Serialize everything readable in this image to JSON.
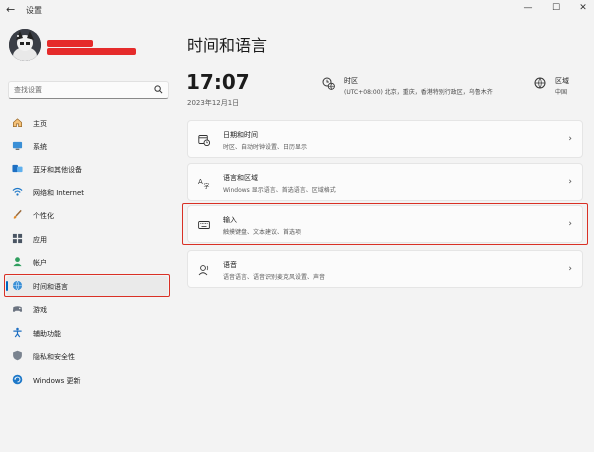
{
  "window": {
    "title": "设置",
    "back_glyph": "←",
    "minimize_glyph": "—",
    "maximize_glyph": "☐",
    "close_glyph": "✕"
  },
  "search": {
    "placeholder": "查找设置"
  },
  "sidebar": {
    "items": [
      {
        "label": "主页",
        "icon": "home-icon"
      },
      {
        "label": "系统",
        "icon": "system-monitor-icon"
      },
      {
        "label": "蓝牙和其他设备",
        "icon": "bluetooth-icon"
      },
      {
        "label": "网络和 Internet",
        "icon": "wifi-icon"
      },
      {
        "label": "个性化",
        "icon": "brush-icon"
      },
      {
        "label": "应用",
        "icon": "apps-icon"
      },
      {
        "label": "帐户",
        "icon": "account-icon"
      },
      {
        "label": "时间和语言",
        "icon": "globe-clock-icon",
        "selected": true
      },
      {
        "label": "游戏",
        "icon": "gamepad-icon"
      },
      {
        "label": "辅助功能",
        "icon": "accessibility-icon"
      },
      {
        "label": "隐私和安全性",
        "icon": "shield-icon"
      },
      {
        "label": "Windows 更新",
        "icon": "update-icon"
      }
    ]
  },
  "main": {
    "title": "时间和语言",
    "time": "17:07",
    "date": "2023年12月1日",
    "timezone": {
      "label": "时区",
      "value": "(UTC+08:00) 北京，重庆，香港特别行政区，乌鲁木齐"
    },
    "region": {
      "label": "区域",
      "value": "中国"
    },
    "cards": [
      {
        "title": "日期和时间",
        "subtitle": "时区、自动时钟设置、日历显示",
        "icon": "calendar-clock-icon"
      },
      {
        "title": "语言和区域",
        "subtitle": "Windows 显示语言、首选语言、区域格式",
        "icon": "language-region-icon"
      },
      {
        "title": "输入",
        "subtitle": "触摸键盘、文本建议、首选项",
        "icon": "keyboard-icon"
      },
      {
        "title": "语音",
        "subtitle": "语音语言、语音识别麦克风设置、声音",
        "icon": "speech-icon"
      }
    ],
    "chevron_glyph": "›"
  },
  "colors": {
    "accent": "#0067c0",
    "annotation_red": "#d93025",
    "background": "#f3f3f3",
    "card": "#fbfbfb"
  }
}
